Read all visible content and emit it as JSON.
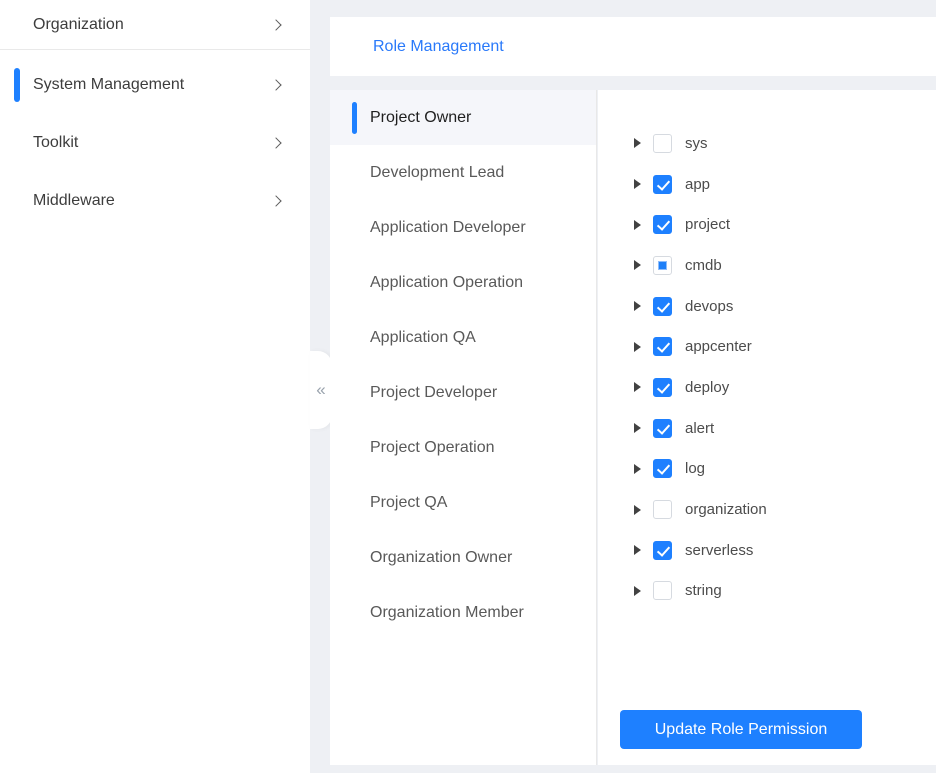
{
  "colors": {
    "accent_blue": "#1e80ff",
    "title_blue": "#2979fa",
    "page_background": "#eef0f4",
    "panel_background": "#ffffff",
    "selected_row_background": "#f5f6fa"
  },
  "sidebar": {
    "collapse_icon": "«",
    "items": [
      {
        "label": "Organization",
        "selected": false
      },
      {
        "label": "System Management",
        "selected": true
      },
      {
        "label": "Toolkit",
        "selected": false
      },
      {
        "label": "Middleware",
        "selected": false
      }
    ]
  },
  "header": {
    "title": "Role Management"
  },
  "roles": {
    "items": [
      {
        "label": "Project Owner",
        "selected": true
      },
      {
        "label": "Development Lead",
        "selected": false
      },
      {
        "label": "Application Developer",
        "selected": false
      },
      {
        "label": "Application Operation",
        "selected": false
      },
      {
        "label": "Application QA",
        "selected": false
      },
      {
        "label": "Project Developer",
        "selected": false
      },
      {
        "label": "Project Operation",
        "selected": false
      },
      {
        "label": "Project QA",
        "selected": false
      },
      {
        "label": "Organization Owner",
        "selected": false
      },
      {
        "label": "Organization Member",
        "selected": false
      }
    ]
  },
  "tree": {
    "items": [
      {
        "label": "sys",
        "state": "unchecked"
      },
      {
        "label": "app",
        "state": "checked"
      },
      {
        "label": "project",
        "state": "checked"
      },
      {
        "label": "cmdb",
        "state": "indeterminate"
      },
      {
        "label": "devops",
        "state": "checked"
      },
      {
        "label": "appcenter",
        "state": "checked"
      },
      {
        "label": "deploy",
        "state": "checked"
      },
      {
        "label": "alert",
        "state": "checked"
      },
      {
        "label": "log",
        "state": "checked"
      },
      {
        "label": "organization",
        "state": "unchecked"
      },
      {
        "label": "serverless",
        "state": "checked"
      },
      {
        "label": "string",
        "state": "unchecked"
      }
    ]
  },
  "actions": {
    "update_button_label": "Update Role Permission"
  }
}
